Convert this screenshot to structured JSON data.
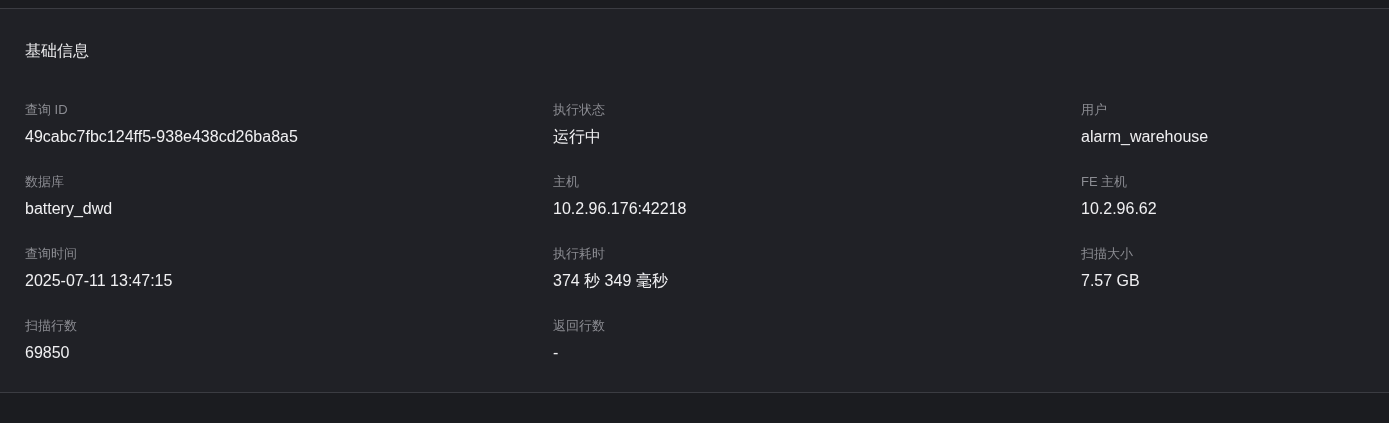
{
  "section": {
    "title": "基础信息"
  },
  "fields": [
    {
      "label": "查询 ID",
      "value": "49cabc7fbc124ff5-938e438cd26ba8a5"
    },
    {
      "label": "执行状态",
      "value": "运行中"
    },
    {
      "label": "用户",
      "value": "alarm_warehouse"
    },
    {
      "label": "数据库",
      "value": "battery_dwd"
    },
    {
      "label": "主机",
      "value": "10.2.96.176:42218"
    },
    {
      "label": "FE 主机",
      "value": "10.2.96.62"
    },
    {
      "label": "查询时间",
      "value": "2025-07-11 13:47:15"
    },
    {
      "label": "执行耗时",
      "value": "374 秒 349 毫秒"
    },
    {
      "label": "扫描大小",
      "value": "7.57 GB"
    },
    {
      "label": "扫描行数",
      "value": "69850"
    },
    {
      "label": "返回行数",
      "value": "-"
    }
  ]
}
